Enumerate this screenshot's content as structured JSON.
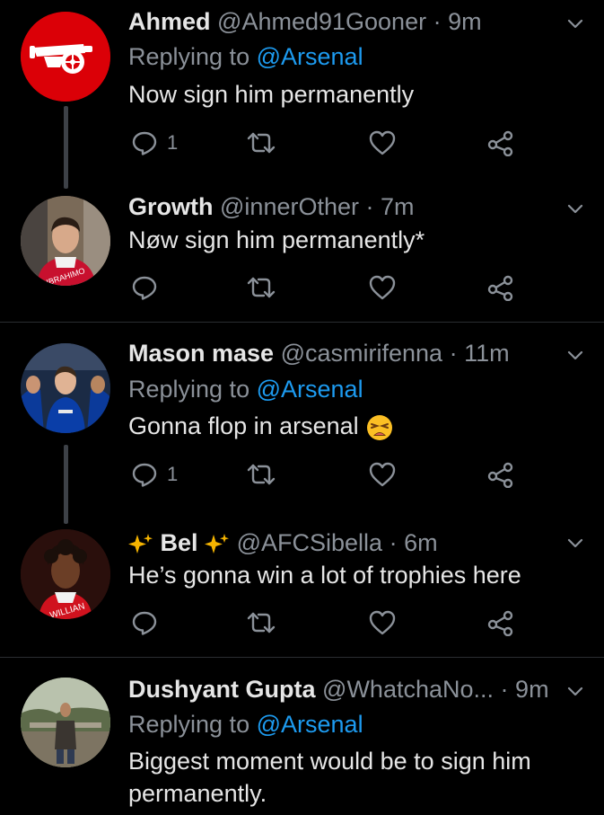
{
  "tweets": [
    {
      "name": "Ahmed",
      "handle": "@Ahmed91Gooner",
      "sep": "·",
      "time": "9m",
      "replying_prefix": "Replying to",
      "replying_to": "@Arsenal",
      "text": "Now sign him permanently",
      "reply_count": "1",
      "avatar_icon": "arsenal-cannon-logo"
    },
    {
      "name": "Growth",
      "handle": "@innerOther",
      "sep": "·",
      "time": "7m",
      "text": "Nøw sign him permanently*",
      "reply_count": "",
      "jersey_text": "IBRAHIMO"
    },
    {
      "name": "Mason mase",
      "handle": "@casmirifenna",
      "sep": "·",
      "time": "11m",
      "replying_prefix": "Replying to",
      "replying_to": "@Arsenal",
      "text": "Gonna flop in arsenal",
      "emoji": "tired-face-emoji",
      "reply_count": "1"
    },
    {
      "name": "Bel",
      "handle": "@AFCSibella",
      "sep": "·",
      "time": "6m",
      "text": "He’s gonna win a lot of trophies here",
      "reply_count": "",
      "jersey_text": "WILLIAN"
    },
    {
      "name": "Dushyant Gupta",
      "handle": "@WhatchaNo...",
      "sep": "·",
      "time": "9m",
      "replying_prefix": "Replying to",
      "replying_to": "@Arsenal",
      "text_line1": "Biggest moment would be to sign him",
      "text_line2": "permanently."
    }
  ],
  "colors": {
    "background": "#000000",
    "mention": "#1d9bf0",
    "muted": "#8b9199",
    "arsenal_red": "#db0007"
  }
}
